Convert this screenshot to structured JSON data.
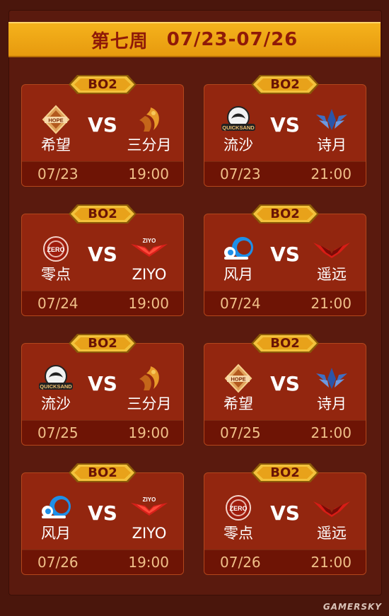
{
  "header": {
    "week": "第七周",
    "range": "07/23-07/26"
  },
  "matches": [
    {
      "format": "BO2",
      "left": {
        "name": "希望",
        "logo": "hope-logo-icon"
      },
      "vs": "VS",
      "right": {
        "name": "三分月",
        "logo": "sanfenyue-logo-icon"
      },
      "date": "07/23",
      "time": "19:00"
    },
    {
      "format": "BO2",
      "left": {
        "name": "流沙",
        "logo": "quicksand-logo-icon"
      },
      "vs": "VS",
      "right": {
        "name": "诗月",
        "logo": "shiyue-logo-icon"
      },
      "date": "07/23",
      "time": "21:00"
    },
    {
      "format": "BO2",
      "left": {
        "name": "零点",
        "logo": "zero-logo-icon"
      },
      "vs": "VS",
      "right": {
        "name": "ZIYO",
        "logo": "ziyo-logo-icon"
      },
      "date": "07/24",
      "time": "19:00"
    },
    {
      "format": "BO2",
      "left": {
        "name": "风月",
        "logo": "fengyue-logo-icon"
      },
      "vs": "VS",
      "right": {
        "name": "遥远",
        "logo": "yaoyuan-logo-icon"
      },
      "date": "07/24",
      "time": "21:00"
    },
    {
      "format": "BO2",
      "left": {
        "name": "流沙",
        "logo": "quicksand-logo-icon"
      },
      "vs": "VS",
      "right": {
        "name": "三分月",
        "logo": "sanfenyue-logo-icon"
      },
      "date": "07/25",
      "time": "19:00"
    },
    {
      "format": "BO2",
      "left": {
        "name": "希望",
        "logo": "hope-logo-icon"
      },
      "vs": "VS",
      "right": {
        "name": "诗月",
        "logo": "shiyue-logo-icon"
      },
      "date": "07/25",
      "time": "21:00"
    },
    {
      "format": "BO2",
      "left": {
        "name": "风月",
        "logo": "fengyue-logo-icon"
      },
      "vs": "VS",
      "right": {
        "name": "ZIYO",
        "logo": "ziyo-logo-icon"
      },
      "date": "07/26",
      "time": "19:00"
    },
    {
      "format": "BO2",
      "left": {
        "name": "零点",
        "logo": "zero-logo-icon"
      },
      "vs": "VS",
      "right": {
        "name": "遥远",
        "logo": "yaoyuan-logo-icon"
      },
      "date": "07/26",
      "time": "21:00"
    }
  ],
  "logo_text": {
    "hope": "HOPE",
    "quicksand": "QUICKSAND",
    "zero": "ZERO",
    "ziyo": "ZIYO"
  },
  "watermark": "GAMERSKY",
  "colors": {
    "header": "#f0a812",
    "card": "#93260f",
    "timebar": "#6e1405",
    "time_text": "#f0c089",
    "badge": "#e8a21a"
  }
}
